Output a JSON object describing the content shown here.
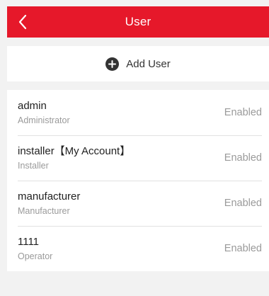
{
  "header": {
    "title": "User",
    "back_icon": "chevron-left-icon",
    "background_color": "#e6182a"
  },
  "add_user": {
    "icon": "plus-circle-icon",
    "label": "Add User"
  },
  "users": [
    {
      "name": "admin",
      "role": "Administrator",
      "status": "Enabled"
    },
    {
      "name": "installer【My Account】",
      "role": "Installer",
      "status": "Enabled"
    },
    {
      "name": "manufacturer",
      "role": "Manufacturer",
      "status": "Enabled"
    },
    {
      "name": "1111",
      "role": "Operator",
      "status": "Enabled"
    }
  ]
}
